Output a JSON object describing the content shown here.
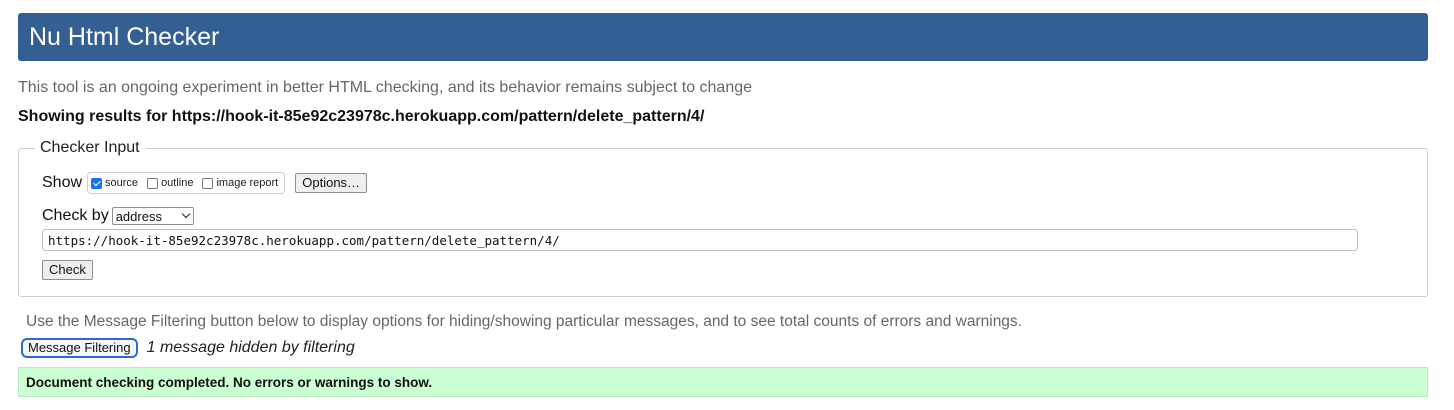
{
  "header": {
    "title": "Nu Html Checker"
  },
  "intro": "This tool is an ongoing experiment in better HTML checking, and its behavior remains subject to change",
  "results": {
    "heading": "Showing results for https://hook-it-85e92c23978c.herokuapp.com/pattern/delete_pattern/4/"
  },
  "checker_input": {
    "legend": "Checker Input",
    "show_label": "Show",
    "options": [
      {
        "label": "source",
        "checked": true
      },
      {
        "label": "outline",
        "checked": false
      },
      {
        "label": "image report",
        "checked": false
      }
    ],
    "options_button": "Options…",
    "check_by_label": "Check by",
    "check_by_value": "address",
    "url_value": "https://hook-it-85e92c23978c.herokuapp.com/pattern/delete_pattern/4/",
    "check_button": "Check"
  },
  "filtering": {
    "info": "Use the Message Filtering button below to display options for hiding/showing particular messages, and to see total counts of errors and warnings.",
    "button": "Message Filtering",
    "hidden_message": "1 message hidden by filtering"
  },
  "status": {
    "message": "Document checking completed. No errors or warnings to show."
  },
  "colors": {
    "header_bg": "#335f92",
    "success_bg": "#ccffd2",
    "checkbox_accent": "#1a73e8"
  }
}
